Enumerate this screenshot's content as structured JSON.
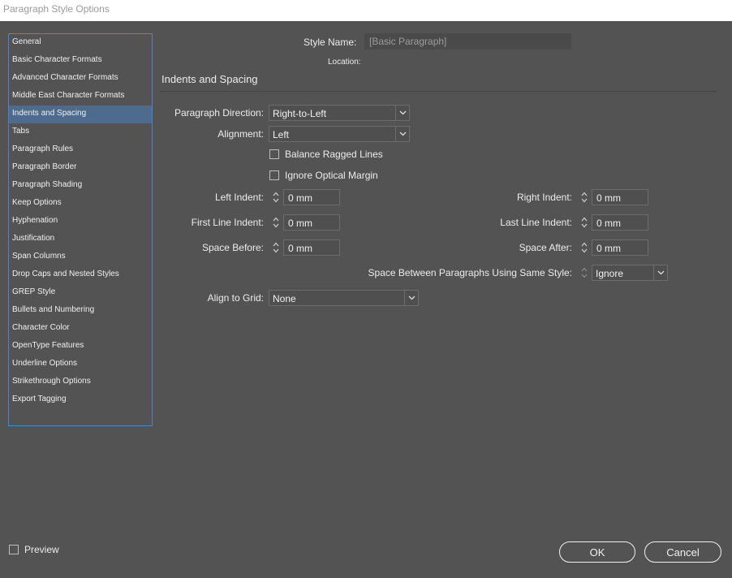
{
  "window": {
    "title": "Paragraph Style Options"
  },
  "sidebar": {
    "items": [
      {
        "label": "General"
      },
      {
        "label": "Basic Character Formats"
      },
      {
        "label": "Advanced Character Formats"
      },
      {
        "label": "Middle East Character Formats"
      },
      {
        "label": "Indents and Spacing",
        "selected": true
      },
      {
        "label": "Tabs"
      },
      {
        "label": "Paragraph Rules"
      },
      {
        "label": "Paragraph Border"
      },
      {
        "label": "Paragraph Shading"
      },
      {
        "label": "Keep Options"
      },
      {
        "label": "Hyphenation"
      },
      {
        "label": "Justification"
      },
      {
        "label": "Span Columns"
      },
      {
        "label": "Drop Caps and Nested Styles"
      },
      {
        "label": "GREP Style"
      },
      {
        "label": "Bullets and Numbering"
      },
      {
        "label": "Character Color"
      },
      {
        "label": "OpenType Features"
      },
      {
        "label": "Underline Options"
      },
      {
        "label": "Strikethrough Options"
      },
      {
        "label": "Export Tagging"
      }
    ]
  },
  "header": {
    "style_name_label": "Style Name:",
    "style_name_value": "[Basic Paragraph]",
    "location_label": "Location:"
  },
  "section": {
    "title": "Indents and Spacing"
  },
  "form": {
    "paragraph_direction": {
      "label": "Paragraph Direction:",
      "value": "Right-to-Left"
    },
    "alignment": {
      "label": "Alignment:",
      "value": "Left"
    },
    "balance_ragged_lines": {
      "label": "Balance Ragged Lines",
      "checked": false
    },
    "ignore_optical_margin": {
      "label": "Ignore Optical Margin",
      "checked": false
    },
    "left_indent": {
      "label": "Left Indent:",
      "value": "0 mm"
    },
    "right_indent": {
      "label": "Right Indent:",
      "value": "0 mm"
    },
    "first_line_indent": {
      "label": "First Line Indent:",
      "value": "0 mm"
    },
    "last_line_indent": {
      "label": "Last Line Indent:",
      "value": "0 mm"
    },
    "space_before": {
      "label": "Space Before:",
      "value": "0 mm"
    },
    "space_after": {
      "label": "Space After:",
      "value": "0 mm"
    },
    "space_between": {
      "label": "Space Between Paragraphs Using Same Style:",
      "value": "Ignore"
    },
    "align_to_grid": {
      "label": "Align to Grid:",
      "value": "None"
    }
  },
  "footer": {
    "preview_label": "Preview",
    "preview_checked": false,
    "ok_label": "OK",
    "cancel_label": "Cancel"
  },
  "colors": {
    "background": "#535353",
    "selection": "#4d6a8f",
    "sidebar_border": "#4a86c5"
  }
}
